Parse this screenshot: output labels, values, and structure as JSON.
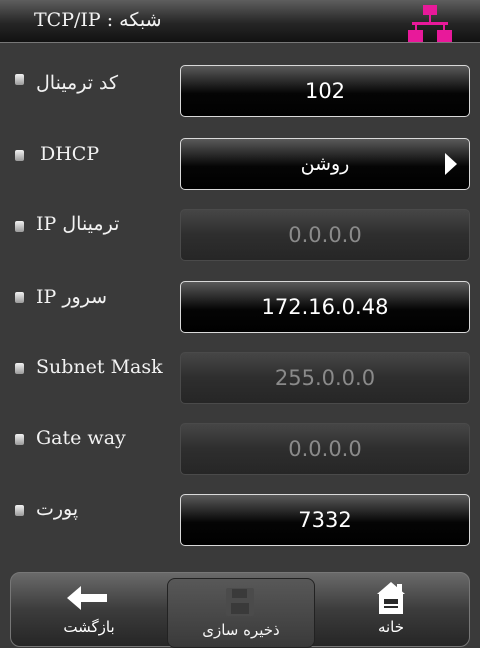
{
  "header": {
    "title": "شبکه : TCP/IP"
  },
  "fields": {
    "terminal_code": {
      "label": "کد ترمینال",
      "value": "102"
    },
    "dhcp": {
      "label": "DHCP",
      "value": "روشن"
    },
    "terminal_ip": {
      "label": "IP ترمینال",
      "value": "0.0.0.0"
    },
    "server_ip": {
      "label": "IP سرور",
      "value": "172.16.0.48"
    },
    "subnet_mask": {
      "label": "Subnet Mask",
      "value": "255.0.0.0"
    },
    "gateway": {
      "label": "Gate way",
      "value": "0.0.0.0"
    },
    "port": {
      "label": "پورت",
      "value": "7332"
    }
  },
  "footer": {
    "back_label": "بازگشت",
    "save_label": "ذخیره سازی",
    "home_label": "خانه"
  },
  "colors": {
    "accent": "#e8199a",
    "background": "#3a3a3a"
  },
  "icons": {
    "network": "network-icon",
    "back": "arrow-left-icon",
    "save": "floppy-disk-icon",
    "home": "home-icon"
  }
}
